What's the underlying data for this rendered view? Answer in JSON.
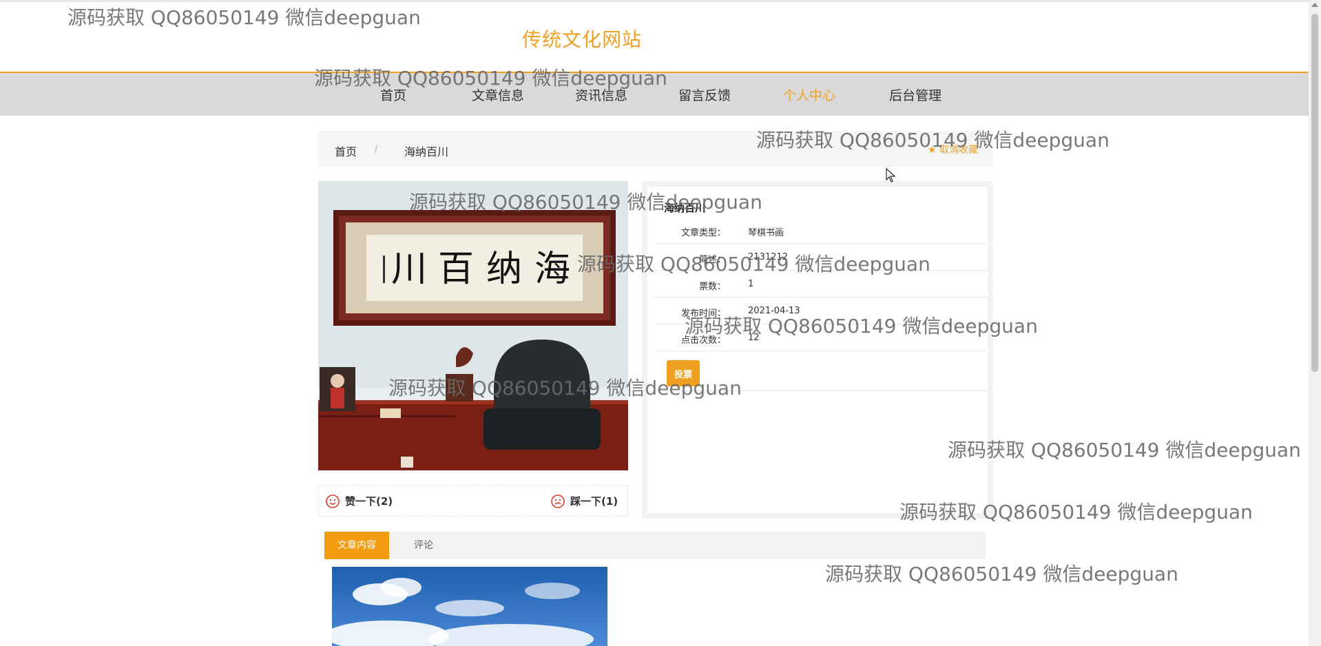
{
  "site": {
    "title": "传统文化网站"
  },
  "nav": [
    {
      "label": "首页",
      "active": false
    },
    {
      "label": "文章信息",
      "active": false
    },
    {
      "label": "资讯信息",
      "active": false
    },
    {
      "label": "留言反馈",
      "active": false
    },
    {
      "label": "个人中心",
      "active": true
    },
    {
      "label": "后台管理",
      "active": false
    }
  ],
  "breadcrumb": {
    "home": "首页",
    "separator": "/",
    "current": "海纳百川",
    "favorite_label": "取消收藏"
  },
  "detail": {
    "title": "海纳百川",
    "rows": [
      {
        "label": "文章类型：",
        "value": "琴棋书画"
      },
      {
        "label": "简述：",
        "value": "2131212"
      },
      {
        "label": "票数：",
        "value": "1"
      },
      {
        "label": "发布时间：",
        "value": "2021-04-13"
      },
      {
        "label": "点击次数：",
        "value": "12"
      }
    ],
    "vote_button": "投票"
  },
  "reactions": {
    "like_label": "赞一下(2)",
    "dislike_label": "踩一下(1)"
  },
  "tabs": [
    {
      "label": "文章内容",
      "active": true
    },
    {
      "label": "评论",
      "active": false
    }
  ],
  "watermark": "源码获取 QQ86050149 微信deepguan",
  "colors": {
    "accent": "#f0a020",
    "navbar": "#d9d9d9",
    "tab_active": "#f39c12"
  }
}
